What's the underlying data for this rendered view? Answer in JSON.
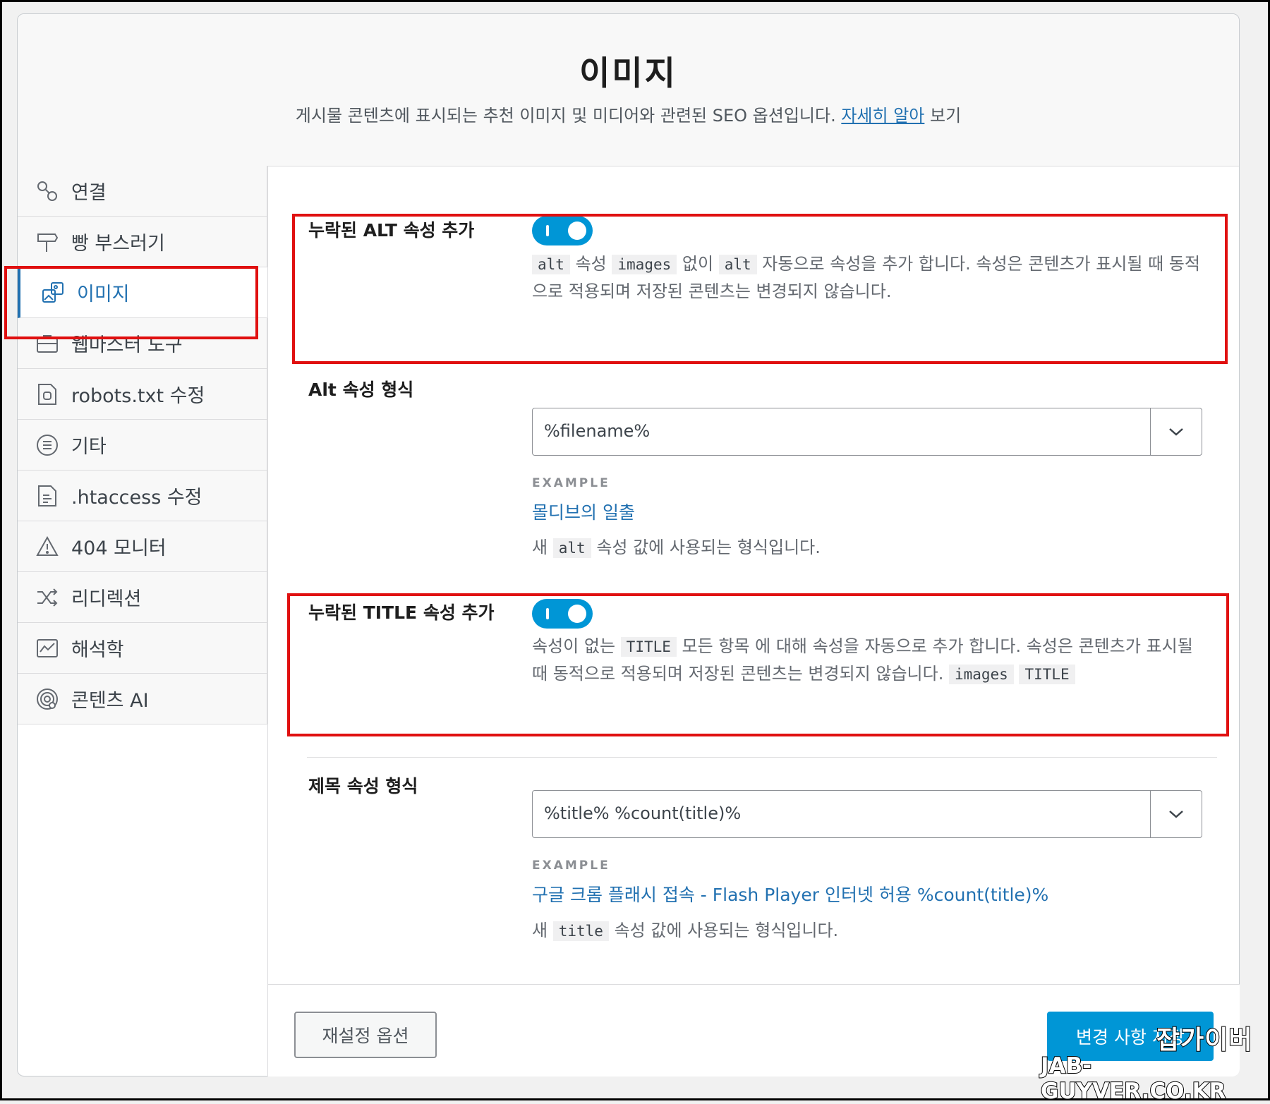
{
  "header": {
    "title": "이미지",
    "description": "게시물 콘텐츠에 표시되는 추천 이미지 및 미디어와 관련된 SEO 옵션입니다.",
    "learn_more_link": "자세히 알아",
    "learn_more_suffix": "보기"
  },
  "sidebar": {
    "items": [
      {
        "label": "연결",
        "icon": "link-icon"
      },
      {
        "label": "빵 부스러기",
        "icon": "signpost-icon"
      },
      {
        "label": "이미지",
        "icon": "image-icon",
        "active": true
      },
      {
        "label": "웹마스터 도구",
        "icon": "toolbox-icon"
      },
      {
        "label": "robots.txt 수정",
        "icon": "robot-file-icon"
      },
      {
        "label": "기타",
        "icon": "list-circle-icon"
      },
      {
        "label": ".htaccess 수정",
        "icon": "document-icon"
      },
      {
        "label": "404 모니터",
        "icon": "warning-icon"
      },
      {
        "label": "리디렉션",
        "icon": "shuffle-icon"
      },
      {
        "label": "해석학",
        "icon": "analytics-icon"
      },
      {
        "label": "콘텐츠 AI",
        "icon": "ai-icon"
      }
    ]
  },
  "alt_toggle": {
    "label": "누락된 ALT 속성 추가",
    "enabled": true,
    "help_code1": "alt",
    "help_text1": "속성",
    "help_code2": "images",
    "help_text2": "없이",
    "help_code3": "alt",
    "help_text3": "자동으로 속성을 추가 합니다. 속성은 콘텐츠가 표시될 때 동적으로 적용되며 저장된 콘텐츠는 변경되지 않습니다."
  },
  "alt_format": {
    "label": "Alt 속성 형식",
    "value": "%filename%",
    "example_label": "EXAMPLE",
    "example_value": "몰디브의 일출",
    "help_prefix": "새",
    "help_code": "alt",
    "help_suffix": "속성 값에 사용되는 형식입니다."
  },
  "title_toggle": {
    "label": "누락된 TITLE 속성 추가",
    "enabled": true,
    "help_text1": "속성이 없는",
    "help_code1": "TITLE",
    "help_text2": "모든 항목 에 대해 속성을 자동으로 추가 합니다. 속성은 콘텐츠가 표시될 때 동적으로 적용되며 저장된 콘텐츠는 변경되지 않습니다.",
    "help_code2": "images",
    "help_code3": "TITLE"
  },
  "title_format": {
    "label": "제목 속성 형식",
    "value": "%title% %count(title)%",
    "example_label": "EXAMPLE",
    "example_value": "구글 크롬 플래시 접속 - Flash Player 인터넷 허용 %count(title)%",
    "help_prefix": "새",
    "help_code": "title",
    "help_suffix": "속성 값에 사용되는 형식입니다."
  },
  "footer": {
    "reset_label": "재설정 옵션",
    "save_label": "변경 사항 저장"
  },
  "watermark": {
    "line1": "잡가이버",
    "line2": "JAB-GUYVER.CO.KR"
  },
  "colors": {
    "accent": "#2271b1",
    "toggle": "#0096d6",
    "highlight_box": "#e01010"
  }
}
